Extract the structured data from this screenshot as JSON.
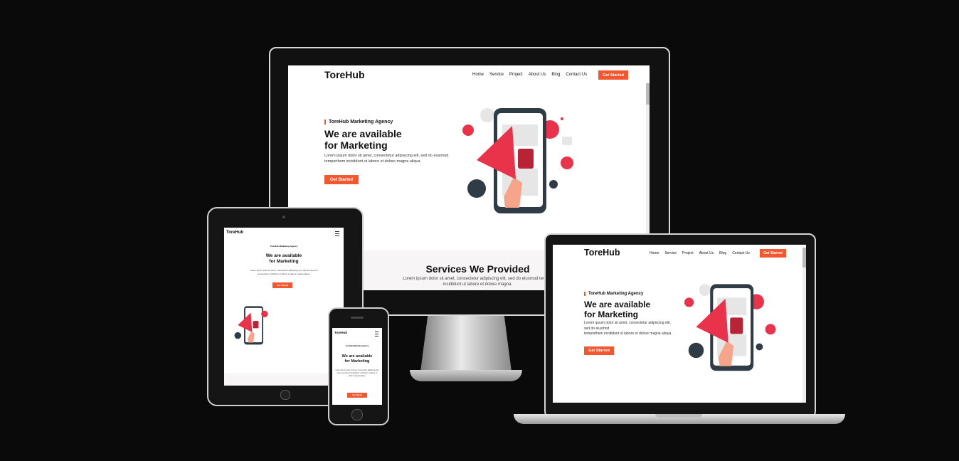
{
  "brand": "ToreHub",
  "nav": [
    "Home",
    "Service",
    "Project",
    "About Us",
    "Blog",
    "Contact Us"
  ],
  "nav_cta": "Get Started",
  "hero": {
    "tag": "ToreHub Marketing Agency",
    "title_line1": "We are available",
    "title_line2": "for Marketing",
    "text_line1": "Lorem ipsum dolor sit amet, consectetur adipiscing elit, sed do eiusmod",
    "text_line2": "temporthem incididunt ut labore et dolore magna aliqua.",
    "cta": "Get Started"
  },
  "services": {
    "title": "Services We Provided",
    "text_line1": "Lorem ipsum dolor sit amet, consectetur adipiscing elit, sed do eiusmod tempor",
    "text_line2": "incididunt ut labore et dolore magna."
  },
  "laptop_hero": {
    "text_line1": "Lorem ipsum dolor sit amet, consectetur adipiscing elit,",
    "text_line2": "sed do eiusmod",
    "text_line3": "temporthem incididunt ut labore et dolore magna aliqua."
  },
  "colors": {
    "accent": "#f4572f",
    "background": "#0b0a0a",
    "megaphone": "#e8334a",
    "phone": "#2f3b45"
  }
}
